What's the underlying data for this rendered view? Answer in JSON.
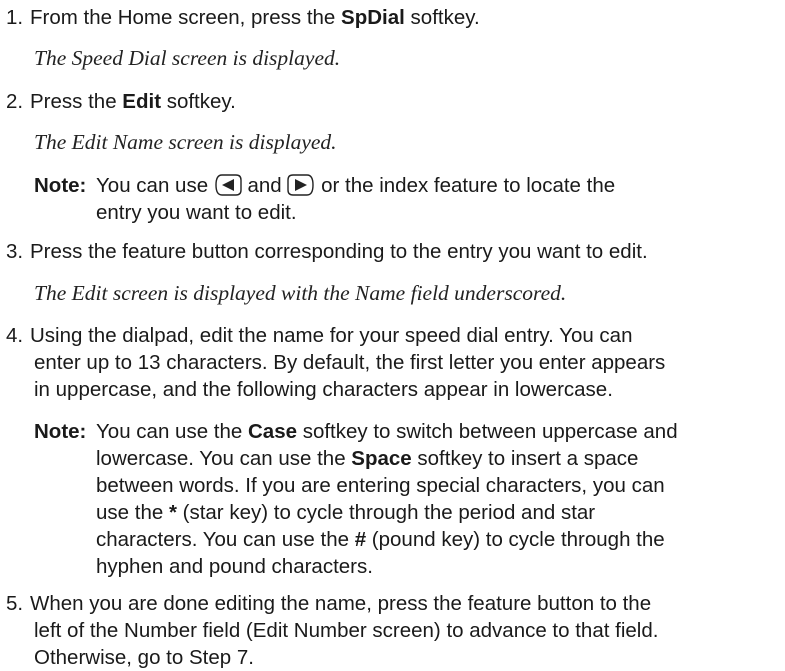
{
  "steps": [
    {
      "number": "1.",
      "before": "From the Home screen, press the ",
      "bold": "SpDial",
      "after": " softkey.",
      "result": "The Speed Dial screen is displayed."
    },
    {
      "number": "2.",
      "before": "Press the ",
      "bold": "Edit",
      "after": " softkey.",
      "result": "The Edit Name screen is displayed.",
      "note": {
        "label": "Note:",
        "part1": "You can use ",
        "part2": " and ",
        "part3": " or the index feature to locate the",
        "line2": "entry you want to edit.",
        "left_icon": "left-arrow-key-icon",
        "right_icon": "right-arrow-key-icon"
      }
    },
    {
      "number": "3.",
      "text": "Press the feature button corresponding to the entry you want to edit.",
      "result": "The Edit screen is displayed with the Name field underscored."
    },
    {
      "number": "4.",
      "lines": [
        "Using the dialpad, edit the name for your speed dial entry. You can",
        "enter up to 13 characters. By default, the first letter you enter appears",
        "in uppercase, and the following characters appear in lowercase."
      ],
      "note": {
        "label": "Note:",
        "l1_a": "You can use the ",
        "l1_b": "Case",
        "l1_c": " softkey to switch between uppercase and",
        "l2": "lowercase. You can use the ",
        "l2_b": "Space",
        "l2_c": " softkey to insert a space",
        "l3": "between words. If you are entering special characters, you can",
        "l4_a": "use the ",
        "l4_b": "*",
        "l4_c": " (star key) to cycle through the period and star",
        "l5_a": "characters. You can use the ",
        "l5_b": "#",
        "l5_c": " (pound key) to cycle through the",
        "l6": "hyphen and pound characters."
      }
    },
    {
      "number": "5.",
      "lines": [
        "When you are done editing the name, press the feature button to the",
        "left of the Number field (Edit Number screen) to advance to that field.",
        "Otherwise, go to Step 7."
      ]
    }
  ]
}
